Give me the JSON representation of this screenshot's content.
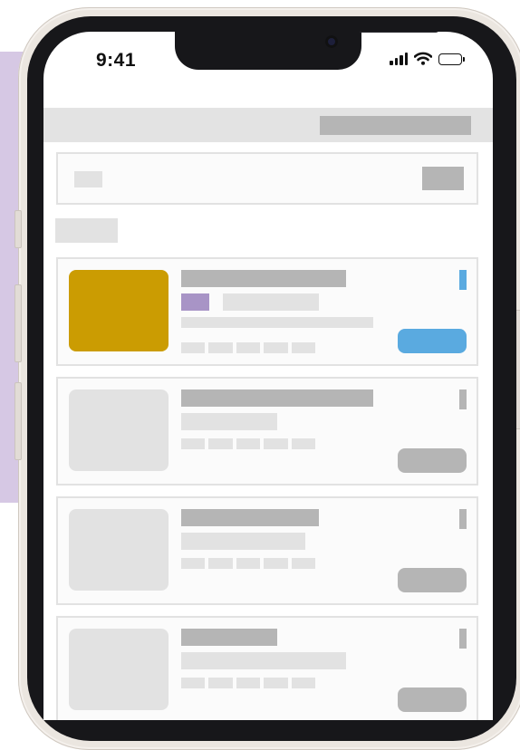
{
  "status_bar": {
    "time": "9:41",
    "icons": [
      "cellular-signal-icon",
      "wifi-icon",
      "battery-icon"
    ]
  },
  "colors": {
    "accent_blue": "#5aaae0",
    "thumbnail_gold": "#cb9c02",
    "tag_purple": "#a894c6",
    "background_lavender": "#d6c8e4",
    "skeleton_dark": "#b5b5b5",
    "skeleton_light": "#e2e2e2"
  },
  "list": {
    "items": [
      {
        "state": "active"
      },
      {
        "state": "placeholder"
      },
      {
        "state": "placeholder"
      },
      {
        "state": "placeholder"
      }
    ]
  }
}
